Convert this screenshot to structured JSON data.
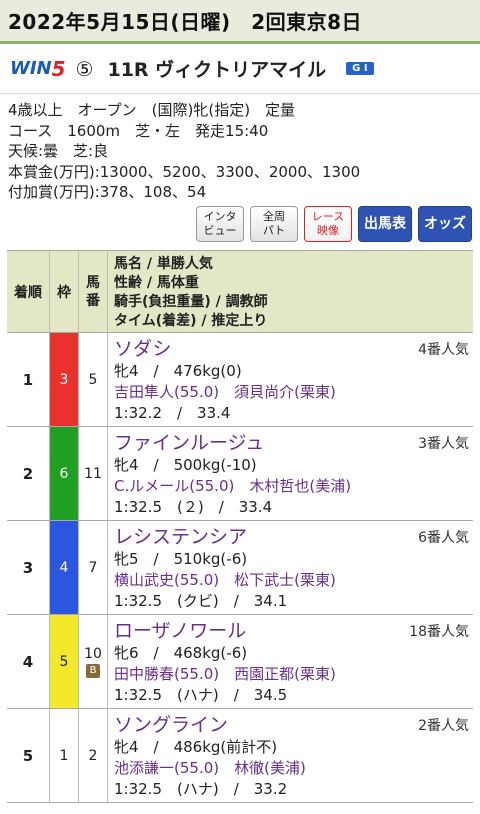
{
  "header": {
    "title": "2022年5月15日(日曜)　2回東京8日"
  },
  "race": {
    "logo_text": "WIN",
    "logo_five": "5",
    "win5_leg": "⑤",
    "name": "11R ヴィクトリアマイル",
    "grade": "G I"
  },
  "info_lines": [
    "4歳以上　オープン　(国際)牝(指定)　定量",
    "コース　1600m　芝・左　発走15:40",
    "天候:曇　芝:良",
    "本賞金(万円):13000、5200、3300、2000、1300",
    "付加賞(万円):378、108、54"
  ],
  "buttons": {
    "interview": "インタ\nビュー",
    "patrol": "全周\nパト",
    "video": "レース\n映像",
    "entries": "出馬表",
    "odds": "オッズ"
  },
  "table_header": {
    "finish": "着順",
    "frame": "枠",
    "number": "馬\n番",
    "detail_1": "馬名 / 単勝人気",
    "detail_2": "性齢 / 馬体重",
    "detail_3": "騎手(負担重量) / 調教師",
    "detail_4": "タイム(着差) / 推定上り"
  },
  "rows": [
    {
      "finish": "1",
      "frame": "3",
      "frame_color": "#e8322c",
      "frame_text": "#ffffff",
      "number": "5",
      "blinker": "",
      "name": "ソダシ",
      "popularity": "4番人気",
      "sex_age": "牝4　/　476kg(0)",
      "jockey": "吉田隼人(55.0)",
      "trainer": "須貝尚介(栗東)",
      "time": "1:32.2　/　33.4"
    },
    {
      "finish": "2",
      "frame": "6",
      "frame_color": "#20a020",
      "frame_text": "#ffffff",
      "number": "11",
      "blinker": "",
      "name": "ファインルージュ",
      "popularity": "3番人気",
      "sex_age": "牝4　/　500kg(-10)",
      "jockey": "C.ルメール(55.0)",
      "trainer": "木村哲也(美浦)",
      "time": "1:32.5　(２)　/　33.4"
    },
    {
      "finish": "3",
      "frame": "4",
      "frame_color": "#2b57e0",
      "frame_text": "#ffffff",
      "number": "7",
      "blinker": "",
      "name": "レシステンシア",
      "popularity": "6番人気",
      "sex_age": "牝5　/　510kg(-6)",
      "jockey": "横山武史(55.0)",
      "trainer": "松下武士(栗東)",
      "time": "1:32.5　(クビ)　/　34.1"
    },
    {
      "finish": "4",
      "frame": "5",
      "frame_color": "#f4e82a",
      "frame_text": "#222222",
      "number": "10",
      "blinker": "B",
      "name": "ローザノワール",
      "popularity": "18番人気",
      "sex_age": "牝6　/　468kg(-6)",
      "jockey": "田中勝春(55.0)",
      "trainer": "西園正都(栗東)",
      "time": "1:32.5　(ハナ)　/　34.5"
    },
    {
      "finish": "5",
      "frame": "1",
      "frame_color": "#ffffff",
      "frame_text": "#222222",
      "number": "2",
      "blinker": "",
      "name": "ソングライン",
      "popularity": "2番人気",
      "sex_age": "牝4　/　486kg(前計不)",
      "jockey": "池添謙一(55.0)",
      "trainer": "林徹(美浦)",
      "time": "1:32.5　(ハナ)　/　33.2"
    }
  ]
}
